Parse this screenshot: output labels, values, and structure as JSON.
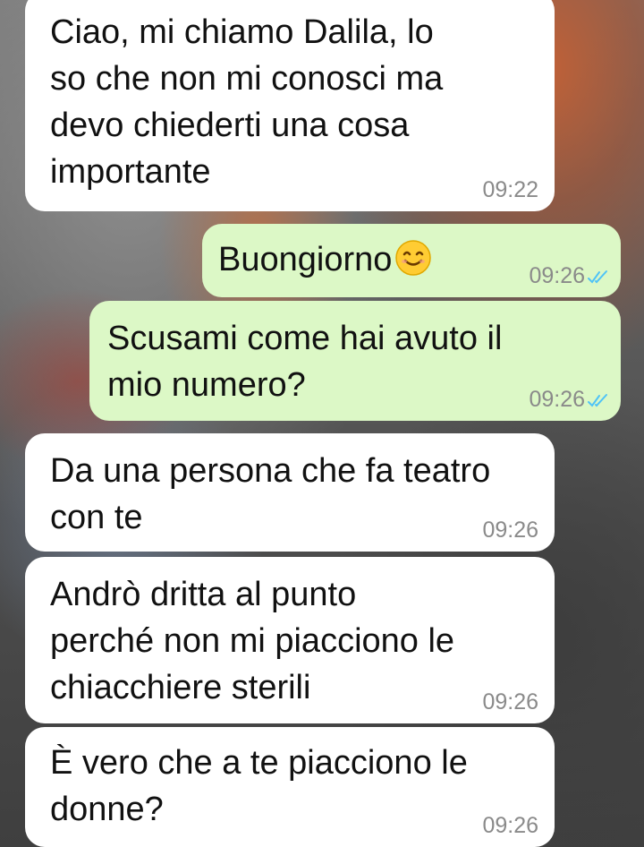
{
  "messages": [
    {
      "direction": "incoming",
      "text": "Ciao, mi chiamo Dalila, lo\nso che non mi conosci ma\ndevo chiederti una cosa\nimportante",
      "time": "09:22"
    },
    {
      "direction": "outgoing",
      "text": "Buongiorno",
      "emoji": "smiling-face-emoji",
      "time": "09:26",
      "status": "read"
    },
    {
      "direction": "outgoing",
      "text": "Scusami come hai avuto il\nmio numero?",
      "time": "09:26",
      "status": "read"
    },
    {
      "direction": "incoming",
      "text": "Da una persona che fa teatro\ncon te",
      "time": "09:26"
    },
    {
      "direction": "incoming",
      "text": "Andrò dritta al punto\nperché non mi piacciono le\nchiacchiere sterili",
      "time": "09:26"
    },
    {
      "direction": "incoming",
      "text": "È vero che a te piacciono le\ndonne?",
      "time": "09:26"
    }
  ],
  "colors": {
    "incoming_bubble": "#ffffff",
    "outgoing_bubble": "#dcf8c6",
    "read_ticks": "#4fc3f7",
    "timestamp": "#8a8a8a"
  }
}
